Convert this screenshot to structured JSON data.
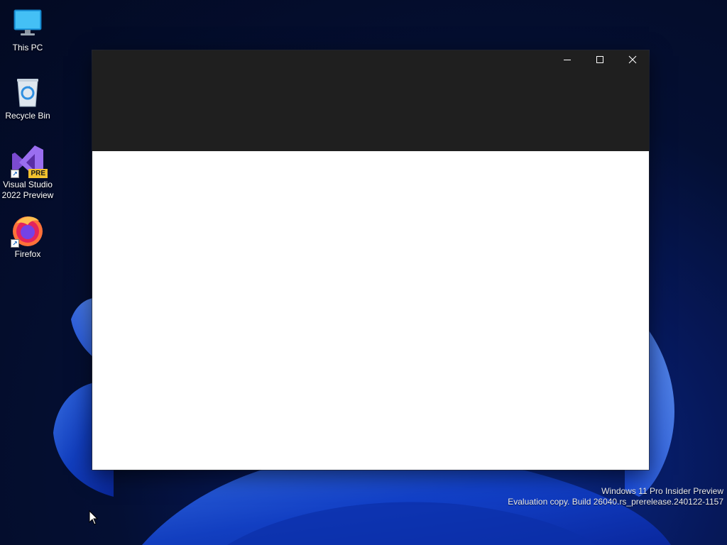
{
  "desktop": {
    "icons": [
      {
        "label": "This PC",
        "icon": "monitor-icon"
      },
      {
        "label": "Recycle Bin",
        "icon": "recycle-bin-icon"
      },
      {
        "label": "Visual Studio 2022 Preview",
        "icon": "visual-studio-icon",
        "badge": "PRE",
        "shortcut": true
      },
      {
        "label": "Firefox",
        "icon": "firefox-icon",
        "shortcut": true
      }
    ]
  },
  "window": {
    "title": "",
    "buttons": [
      {
        "name": "minimize",
        "icon": "minimize-icon"
      },
      {
        "name": "maximize",
        "icon": "maximize-icon"
      },
      {
        "name": "close",
        "icon": "close-icon"
      }
    ],
    "titlebar_color": "#1f1f1f",
    "client_color": "#ffffff"
  },
  "watermark": {
    "line1": "Windows 11 Pro Insider Preview",
    "line2": "Evaluation copy. Build 26040.rs_prerelease.240122-1157"
  }
}
